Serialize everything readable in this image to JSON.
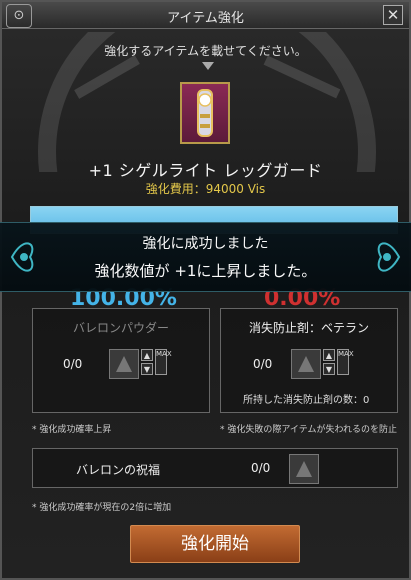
{
  "window": {
    "title": "アイテム強化",
    "logo_glyph": "⊙",
    "close_glyph": "✕"
  },
  "instruction": "強化するアイテムを載せてください。",
  "item": {
    "name": "+1 シゲルライト レッグガード",
    "cost": "強化費用：94000 Vis"
  },
  "notice": {
    "line1": "強化に成功しました",
    "line2": "強化数値が +1に上昇しました。"
  },
  "rates": {
    "success": "100.00%",
    "failure": "0.00%"
  },
  "left_panel": {
    "title": "バレロンパウダー",
    "count": "0/0",
    "max_label": "MAX",
    "note": "* 強化成功確率上昇"
  },
  "right_panel": {
    "title": "消失防止剤：ベテラン",
    "count": "0/0",
    "max_label": "MAX",
    "owned": "所持した消失防止剤の数：0",
    "note": "* 強化失敗の際アイテムが失われるのを防止"
  },
  "blessing_panel": {
    "title": "バレロンの祝福",
    "count": "0/0",
    "note": "* 強化成功確率が現在の2倍に増加"
  },
  "start_button": "強化開始",
  "colors": {
    "success_rate": "#44b4e8",
    "failure_rate": "#d03030",
    "cost": "#e3c74a",
    "start_button": "#c26b32"
  }
}
